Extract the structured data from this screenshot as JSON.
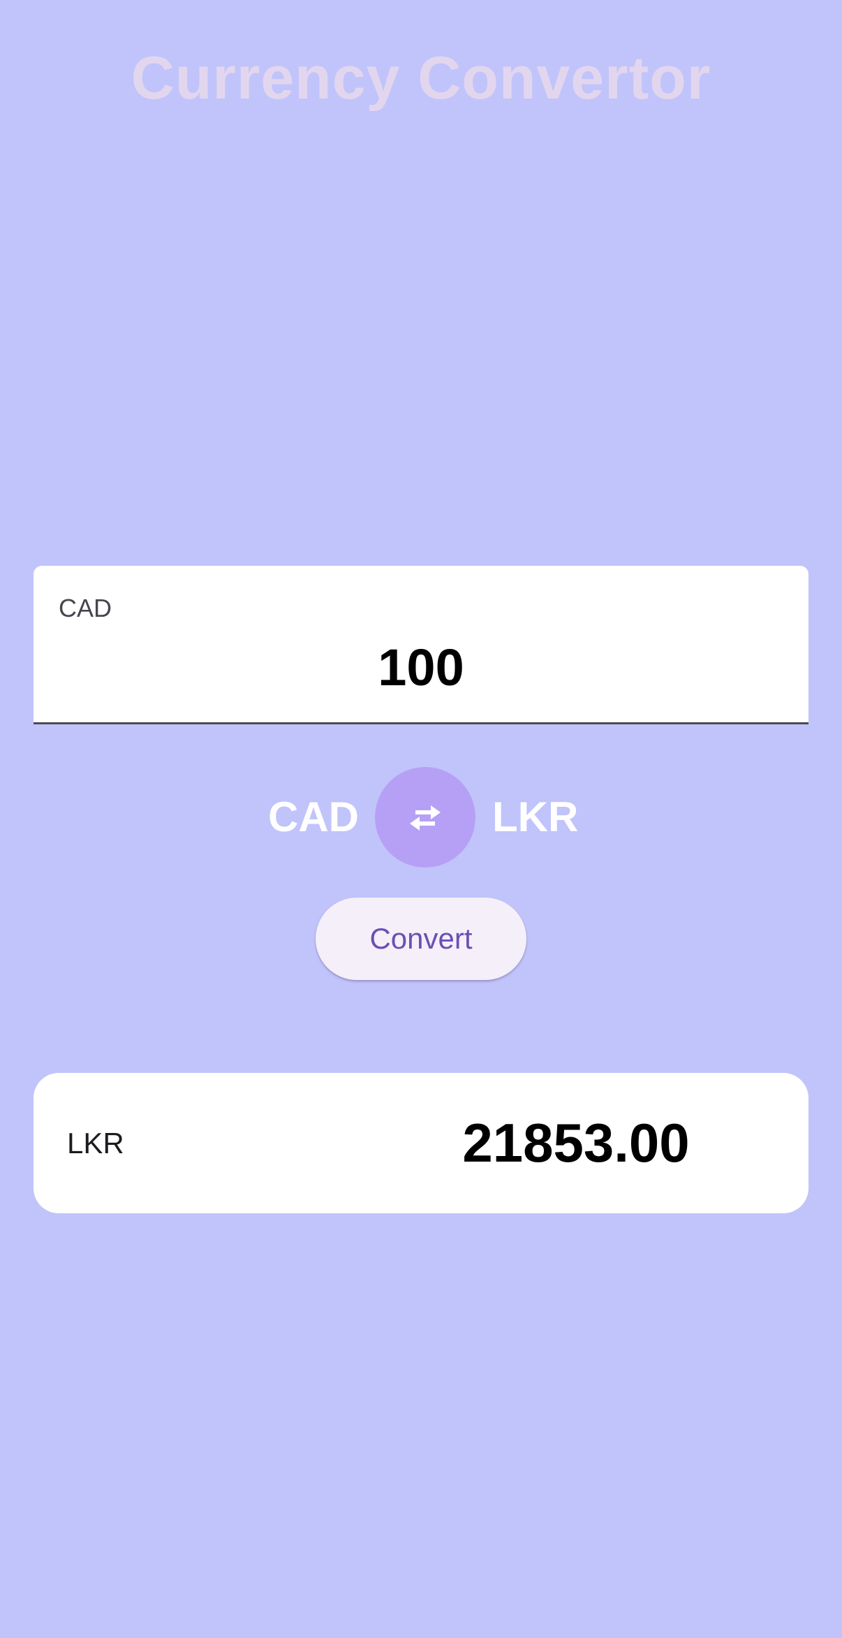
{
  "app": {
    "title": "Currency Convertor"
  },
  "amount_input": {
    "label": "CAD",
    "value": "100"
  },
  "currency_pair": {
    "from": "CAD",
    "to": "LKR",
    "swap_icon": "swap-horizontal-icon"
  },
  "convert_button": {
    "label": "Convert"
  },
  "result": {
    "currency": "LKR",
    "value": "21853.00"
  },
  "colors": {
    "background": "#c1c4fa",
    "title": "#e2d6ef",
    "swap_button": "#b6a0f5",
    "convert_button_bg": "#f5eff9",
    "convert_button_text": "#6a4fb6"
  }
}
